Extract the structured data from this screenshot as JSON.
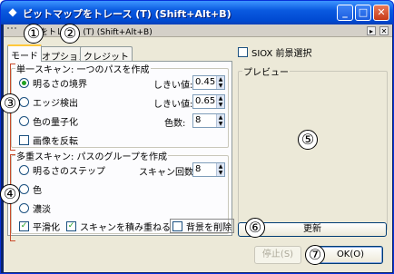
{
  "window": {
    "title": "ビットマップをトレース (T)  (Shift+Alt+B)",
    "minimize": "_",
    "maximize": "□",
    "close": "✕"
  },
  "dock": {
    "title": "ップをトレース (T)  (Shift+Alt+B)"
  },
  "tabs": [
    {
      "label": "モード",
      "active": true
    },
    {
      "label": "オプション",
      "active": false
    },
    {
      "label": "クレジット",
      "active": false
    }
  ],
  "single_scan": {
    "legend": "単一スキャン: 一つのパスを作成",
    "options": [
      {
        "label": "明るさの境界",
        "selected": true,
        "param_label": "しきい値:",
        "value": "0.450"
      },
      {
        "label": "エッジ検出",
        "selected": false,
        "param_label": "しきい値:",
        "value": "0.650"
      },
      {
        "label": "色の量子化",
        "selected": false,
        "param_label": "色数:",
        "value": "8"
      }
    ],
    "invert_label": "画像を反転",
    "invert_checked": false
  },
  "multi_scan": {
    "legend": "多重スキャン: パスのグループを作成",
    "options": [
      {
        "label": "明るさのステップ",
        "selected": false,
        "param_label": "スキャン回数:",
        "value": "8"
      },
      {
        "label": "色",
        "selected": false
      },
      {
        "label": "濃淡",
        "selected": false
      }
    ],
    "smooth_label": "平滑化",
    "smooth_checked": true,
    "stack_label": "スキャンを積み重ねる",
    "stack_checked": true,
    "remove_bg_label": "背景を削除",
    "remove_bg_checked": false
  },
  "siox_label": "SIOX 前景選択",
  "preview_legend": "プレビュー",
  "update_button": "更新",
  "stop_button": "停止(S)",
  "ok_button": "OK(O)",
  "callouts": [
    "①",
    "②",
    "③",
    "④",
    "⑤",
    "⑥",
    "⑦"
  ]
}
